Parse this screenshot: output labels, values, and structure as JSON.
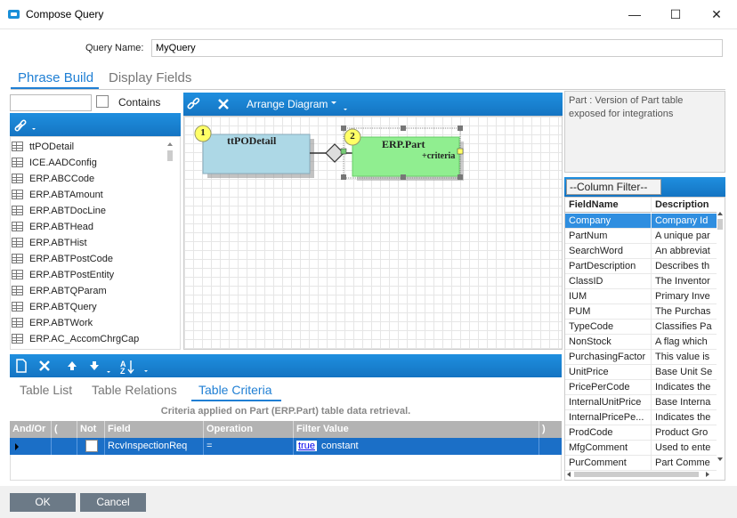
{
  "window": {
    "title": "Compose Query",
    "minimize": "—",
    "maximize": "☐",
    "close": "✕"
  },
  "query_name": {
    "label": "Query Name:",
    "value": "MyQuery"
  },
  "top_tabs": [
    {
      "label": "Phrase Build"
    },
    {
      "label": "Display Fields"
    }
  ],
  "left_panel": {
    "contains_label": "Contains",
    "tables": [
      "ttPODetail",
      "ICE.AADConfig",
      "ERP.ABCCode",
      "ERP.ABTAmount",
      "ERP.ABTDocLine",
      "ERP.ABTHead",
      "ERP.ABTHist",
      "ERP.ABTPostCode",
      "ERP.ABTPostEntity",
      "ERP.ABTQParam",
      "ERP.ABTQuery",
      "ERP.ABTWork",
      "ERP.AC_AccomChrgCap"
    ]
  },
  "diagram": {
    "arrange_label": "Arrange Diagram",
    "node1": {
      "number": "1",
      "name": "ttPODetail"
    },
    "node2": {
      "number": "2",
      "name": "ERP.Part",
      "criteria": "+criteria"
    }
  },
  "description": "Part : Version of Part table exposed for integrations",
  "column_filter": "--Column Filter--",
  "fields_grid": {
    "headers": [
      "FieldName",
      "Description"
    ],
    "rows": [
      [
        "Company",
        "Company Id"
      ],
      [
        "PartNum",
        "A unique par"
      ],
      [
        "SearchWord",
        "An abbreviat"
      ],
      [
        "PartDescription",
        "Describes th"
      ],
      [
        "ClassID",
        "The Inventor"
      ],
      [
        "IUM",
        "Primary Inve"
      ],
      [
        "PUM",
        "The Purchas"
      ],
      [
        "TypeCode",
        "Classifies Pa"
      ],
      [
        "NonStock",
        "A flag which"
      ],
      [
        "PurchasingFactor",
        "This value is"
      ],
      [
        "UnitPrice",
        "Base Unit Se"
      ],
      [
        "PricePerCode",
        "Indicates the"
      ],
      [
        "InternalUnitPrice",
        "Base Interna"
      ],
      [
        "InternalPricePe...",
        "Indicates the"
      ],
      [
        "ProdCode",
        "Product Gro"
      ],
      [
        "MfgComment",
        "Used to ente"
      ],
      [
        "PurComment",
        "Part Comme"
      ]
    ]
  },
  "bottom_tabs": [
    {
      "label": "Table List"
    },
    {
      "label": "Table Relations"
    },
    {
      "label": "Table Criteria"
    }
  ],
  "criteria": {
    "caption": "Criteria applied on Part (ERP.Part)  table data retrieval.",
    "headers": {
      "andor": "And/Or",
      "lparen": "(",
      "not": "Not",
      "field": "Field",
      "operation": "Operation",
      "filter": "Filter Value",
      "rparen": ")"
    },
    "row": {
      "field": "RcvInspectionReq",
      "operation": "=",
      "filter_link": "true",
      "filter_type": "constant"
    }
  },
  "footer": {
    "ok": "OK",
    "cancel": "Cancel"
  },
  "colors": {
    "accent": "#1f7fd4",
    "toolbar": "#1474c2",
    "node1": "#add8e6",
    "node2": "#90ee90",
    "badge": "#ffff66"
  }
}
